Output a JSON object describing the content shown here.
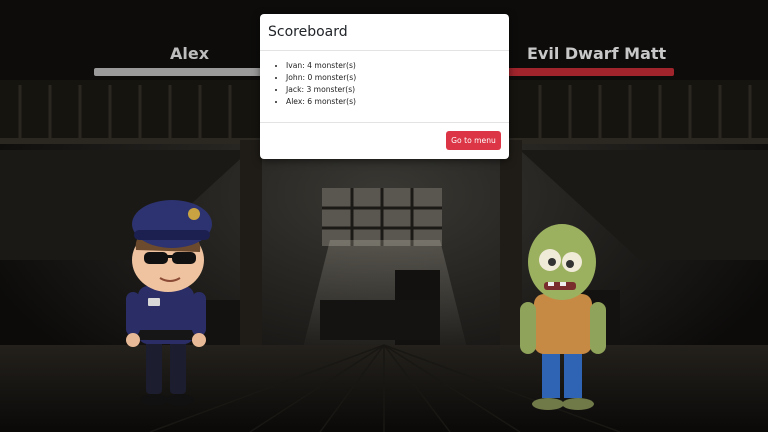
{
  "players": {
    "left": {
      "name": "Alex",
      "health_fraction": 1.0,
      "bar_color": "#9a9a9a"
    },
    "right": {
      "name": "Evil Dwarf Matt",
      "health_fraction": 1.0,
      "bar_color": "#a0242c"
    }
  },
  "modal": {
    "title": "Scoreboard",
    "scores": [
      "Ivan: 4 monster(s)",
      "John: 0 monster(s)",
      "Jack: 3 monster(s)",
      "Alex: 6 monster(s)"
    ],
    "button_label": "Go to menu",
    "button_color": "#dc3545"
  },
  "characters": {
    "hero_icon": "police-officer-icon",
    "enemy_icon": "zombie-icon"
  }
}
